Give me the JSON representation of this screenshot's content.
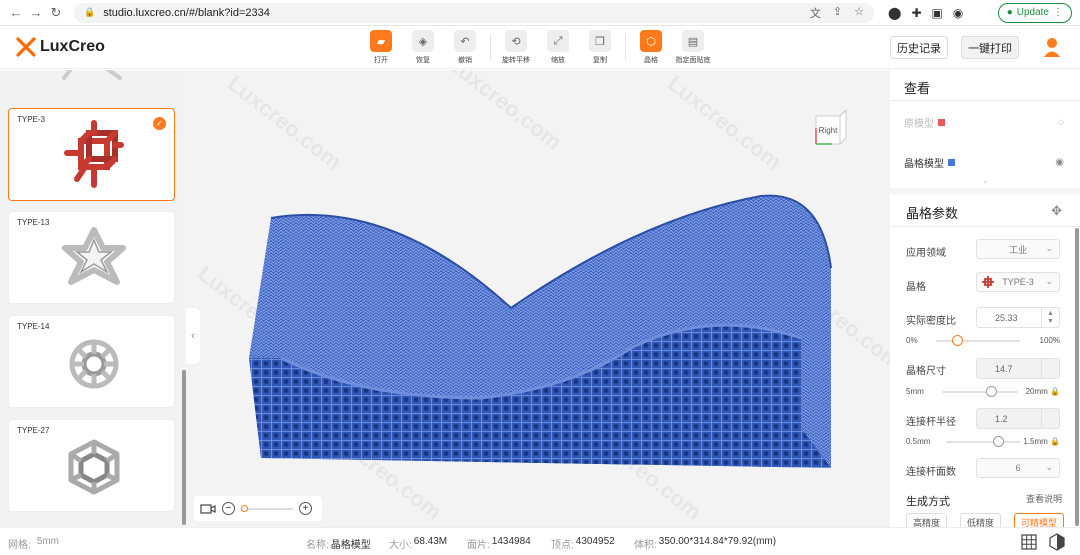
{
  "browser": {
    "url": "studio.luxcreo.cn/#/blank?id=2334",
    "update_label": "Update"
  },
  "app": {
    "brand": "LuxCreo",
    "toolbar": [
      {
        "label": "打开",
        "icon": "folder-icon"
      },
      {
        "label": "恢复",
        "icon": "restore-icon"
      },
      {
        "label": "撤销",
        "icon": "undo-icon"
      },
      {
        "label": "旋转平移",
        "icon": "rotate-move-icon"
      },
      {
        "label": "缩放",
        "icon": "scale-icon"
      },
      {
        "label": "复制",
        "icon": "copy-icon"
      },
      {
        "label": "晶格",
        "icon": "lattice-icon"
      },
      {
        "label": "指定面贴底",
        "icon": "face-to-bottom-icon"
      }
    ],
    "history_label": "历史记录",
    "print_label": "一键打印"
  },
  "lattice_library": [
    {
      "name": "TYPE-3",
      "selected": true
    },
    {
      "name": "TYPE-13",
      "selected": false
    },
    {
      "name": "TYPE-14",
      "selected": false
    },
    {
      "name": "TYPE-27",
      "selected": false
    }
  ],
  "viewport": {
    "watermark": "Luxcreo.com",
    "viewcube_label": "Right"
  },
  "view_panel": {
    "title": "查看",
    "models": [
      {
        "name": "原模型",
        "color": "#e85a5a",
        "visible": false
      },
      {
        "name": "晶格模型",
        "color": "#4a78d6",
        "visible": true
      }
    ]
  },
  "lattice_params": {
    "title": "晶格参数",
    "field_label": "应用领域",
    "field_value": "工业",
    "lattice_label": "晶格",
    "lattice_value": "TYPE-3",
    "density_label": "实际密度比",
    "density_value": "25.33",
    "density_min": "0%",
    "density_max": "100%",
    "density_fraction": 0.2533,
    "size_label": "晶格尺寸",
    "size_value": "14.7",
    "size_min": "5mm",
    "size_max": "20mm",
    "size_fraction": 0.647,
    "rod_label": "连接杆半径",
    "rod_value": "1.2",
    "rod_min": "0.5mm",
    "rod_max": "1.5mm",
    "rod_fraction": 0.7,
    "faces_label": "连接杆面数",
    "faces_value": "6",
    "gen_label": "生成方式",
    "help_label": "查看说明",
    "gen_options": [
      "高精度",
      "低精度",
      "可精模型"
    ]
  },
  "status": {
    "grid_label": "网格:",
    "grid_value": "5mm",
    "name_label": "名称:",
    "name_value": "晶格模型",
    "size_label": "大小:",
    "size_value": "68.43M",
    "faces_label": "面片:",
    "faces_value": "1434984",
    "verts_label": "顶点:",
    "verts_value": "4304952",
    "volume_label": "体积:",
    "volume_value": "350.00*314.84*79.92(mm)"
  }
}
